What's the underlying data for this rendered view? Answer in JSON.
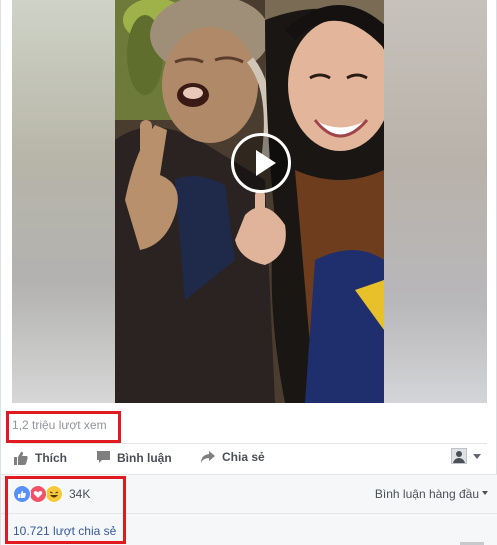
{
  "post": {
    "views_text": "1,2 triệu lượt xem"
  },
  "actions": {
    "like": "Thích",
    "comment": "Bình luận",
    "share": "Chia sẻ"
  },
  "reactions": {
    "count": "34K",
    "icons": [
      "like-icon",
      "love-icon",
      "haha-icon"
    ]
  },
  "comments": {
    "sort_label": "Bình luận hàng đầu"
  },
  "shares": {
    "text": "10.721 lượt chia sẻ"
  },
  "colors": {
    "highlight": "#e01a1f",
    "link": "#365899",
    "like_blue": "#5890ff",
    "love_red": "#f25268",
    "haha_yellow": "#f7c93b"
  }
}
